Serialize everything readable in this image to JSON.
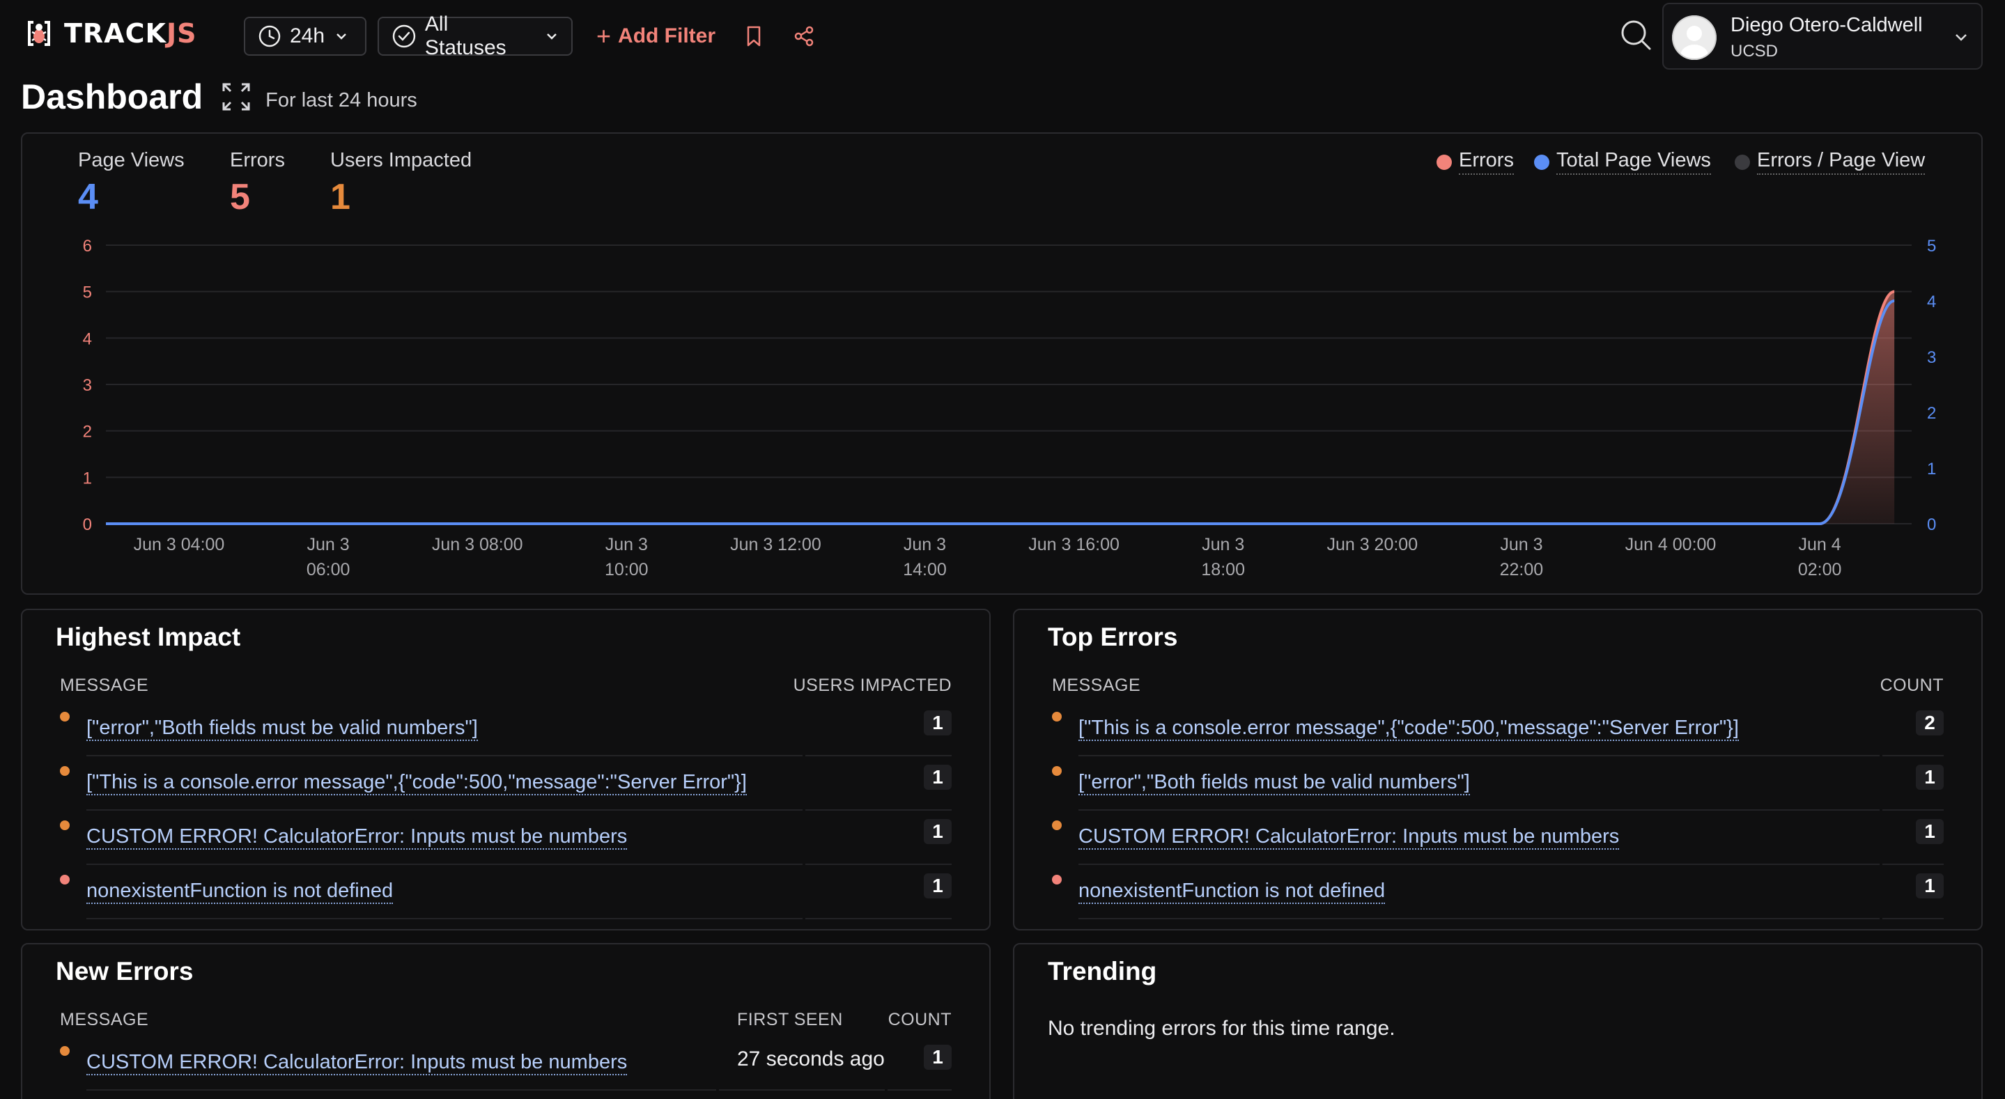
{
  "brand": {
    "prefix": "TRACK",
    "suffix": "JS"
  },
  "toolbar": {
    "range_label": "24h",
    "status_label": "All Statuses",
    "add_filter_label": "Add Filter"
  },
  "user": {
    "name": "Diego Otero-Caldwell",
    "org": "UCSD"
  },
  "page": {
    "title": "Dashboard",
    "subtitle": "For last 24 hours"
  },
  "stats": [
    {
      "label": "Page Views",
      "value": "4",
      "color": "#5b8ef5"
    },
    {
      "label": "Errors",
      "value": "5",
      "color": "#f2837a"
    },
    {
      "label": "Users Impacted",
      "value": "1",
      "color": "#e68a3c"
    }
  ],
  "legend": [
    {
      "label": "Errors",
      "color": "#f2837a"
    },
    {
      "label": "Total Page Views",
      "color": "#5b8ef5"
    },
    {
      "label": "Errors / Page View",
      "color": "#3b3b3f"
    }
  ],
  "chart_data": {
    "type": "area",
    "x_ticks": [
      [
        "Jun 3 04:00"
      ],
      [
        "Jun 3",
        "06:00"
      ],
      [
        "Jun 3 08:00"
      ],
      [
        "Jun 3",
        "10:00"
      ],
      [
        "Jun 3 12:00"
      ],
      [
        "Jun 3",
        "14:00"
      ],
      [
        "Jun 3 16:00"
      ],
      [
        "Jun 3",
        "18:00"
      ],
      [
        "Jun 3 20:00"
      ],
      [
        "Jun 3",
        "22:00"
      ],
      [
        "Jun 4 00:00"
      ],
      [
        "Jun 4",
        "02:00"
      ]
    ],
    "y_left_ticks": [
      "0",
      "1",
      "2",
      "3",
      "4",
      "5",
      "6"
    ],
    "y_right_ticks": [
      "0",
      "1",
      "2",
      "3",
      "4",
      "5"
    ],
    "y_left_range": [
      0,
      6
    ],
    "y_right_range": [
      0,
      5
    ],
    "grid": true,
    "series": [
      {
        "name": "Errors",
        "axis": "left",
        "color": "#f2837a",
        "points": [
          [
            "Jun 3 03:00",
            0
          ],
          [
            "Jun 4 02:00",
            0
          ],
          [
            "Jun 4 03:00",
            5
          ]
        ]
      },
      {
        "name": "Total Page Views",
        "axis": "right",
        "color": "#5b8ef5",
        "points": [
          [
            "Jun 3 03:00",
            0
          ],
          [
            "Jun 4 02:00",
            0
          ],
          [
            "Jun 4 03:00",
            4
          ]
        ]
      }
    ]
  },
  "highest_impact": {
    "title": "Highest Impact",
    "col_message": "MESSAGE",
    "col_value": "USERS IMPACTED",
    "rows": [
      {
        "message": "[\"error\",\"Both fields must be valid numbers\"]",
        "value": "1",
        "color": "#e68a3c"
      },
      {
        "message": "[\"This is a console.error message\",{\"code\":500,\"message\":\"Server Error\"}]",
        "value": "1",
        "color": "#e68a3c"
      },
      {
        "message": "CUSTOM ERROR! CalculatorError: Inputs must be numbers",
        "value": "1",
        "color": "#e68a3c"
      },
      {
        "message": "nonexistentFunction is not defined",
        "value": "1",
        "color": "#f2837a"
      }
    ]
  },
  "top_errors": {
    "title": "Top Errors",
    "col_message": "MESSAGE",
    "col_value": "COUNT",
    "rows": [
      {
        "message": "[\"This is a console.error message\",{\"code\":500,\"message\":\"Server Error\"}]",
        "value": "2",
        "color": "#e68a3c"
      },
      {
        "message": "[\"error\",\"Both fields must be valid numbers\"]",
        "value": "1",
        "color": "#e68a3c"
      },
      {
        "message": "CUSTOM ERROR! CalculatorError: Inputs must be numbers",
        "value": "1",
        "color": "#e68a3c"
      },
      {
        "message": "nonexistentFunction is not defined",
        "value": "1",
        "color": "#f2837a"
      }
    ]
  },
  "new_errors": {
    "title": "New Errors",
    "col_message": "MESSAGE",
    "col_first_seen": "FIRST SEEN",
    "col_count": "COUNT",
    "rows": [
      {
        "message": "CUSTOM ERROR! CalculatorError: Inputs must be numbers",
        "first_seen": "27 seconds ago",
        "count": "1",
        "color": "#e68a3c"
      }
    ]
  },
  "trending": {
    "title": "Trending",
    "empty_text": "No trending errors for this time range."
  }
}
